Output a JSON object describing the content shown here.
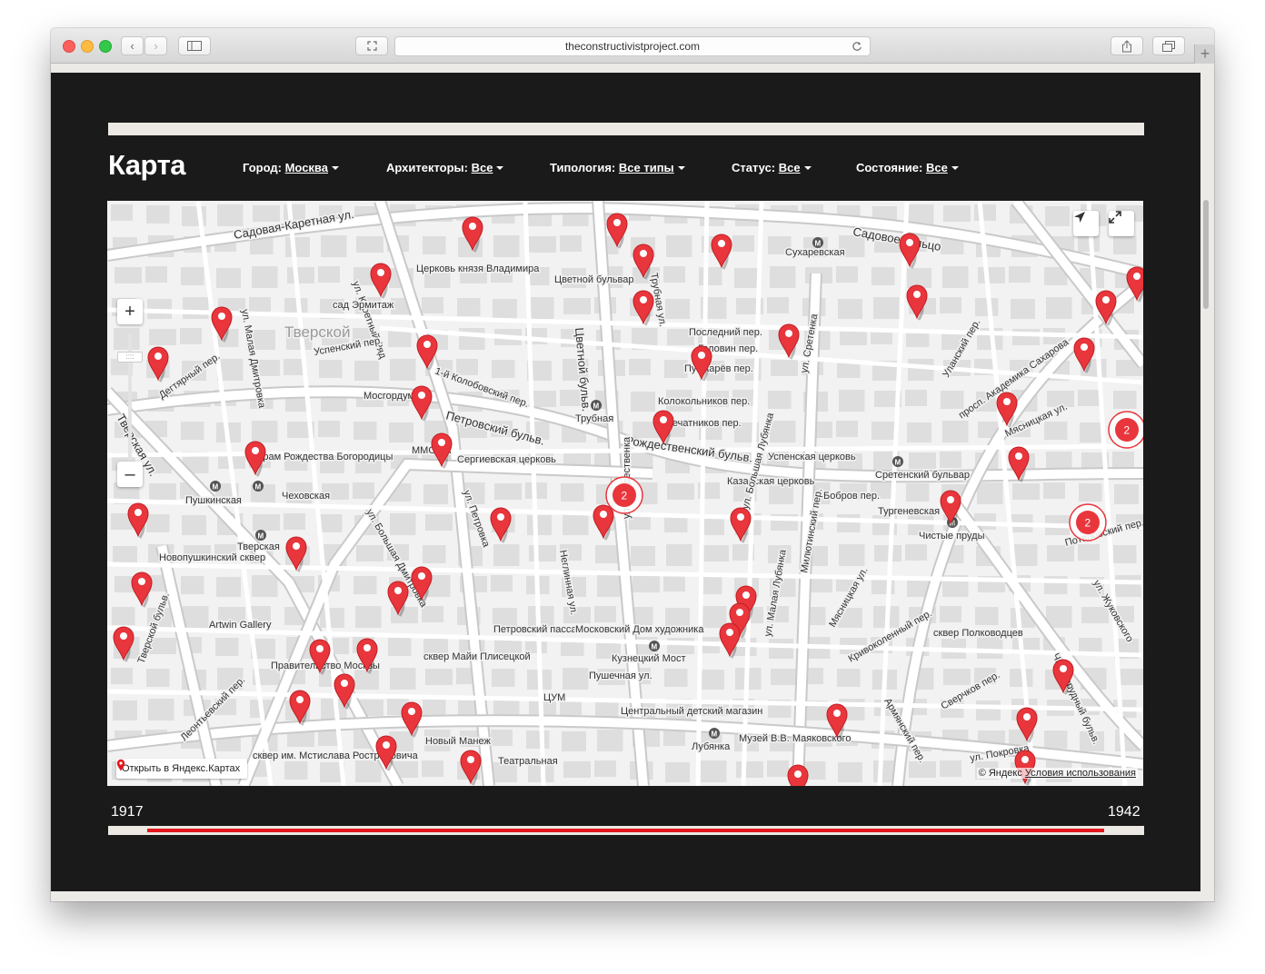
{
  "browser": {
    "url": "theconstructivistproject.com"
  },
  "header": {
    "title": "Карта",
    "filters": [
      {
        "label": "Город:",
        "value": "Москва"
      },
      {
        "label": "Архитекторы:",
        "value": "Все"
      },
      {
        "label": "Типология:",
        "value": "Все типы"
      },
      {
        "label": "Статус:",
        "value": "Все"
      },
      {
        "label": "Состояние:",
        "value": "Все"
      }
    ]
  },
  "map": {
    "open_link": "Открыть в Яндекс.Картах",
    "copyright": "© Яндекс",
    "terms": "Условия использования",
    "clusters": [
      "2",
      "2",
      "2"
    ],
    "labels": [
      "Садовая-Каретная ул.",
      "Садовое кольцо",
      "Сухаревская",
      "Цветной бульвар",
      "Трубная ул.",
      "ул. Каретный Ряд",
      "Церковь князя Владимира",
      "сад Эрмитаж",
      "Тверской",
      "Успенский пер.",
      "ул. Малая Дмитровка",
      "Дегтярный пер.",
      "Тверская ул.",
      "1-й Колобовский пер.",
      "Мосгордума",
      "Петровский бульв.",
      "Цветной бульв.",
      "Трубная",
      "Последний пер.",
      "Головин пер.",
      "Пушкарёв пер.",
      "Колокольников пер.",
      "Печатников пер.",
      "ул. Сретенка",
      "Рождественский бульв.",
      "Успенская церковь",
      "Сретенский бульвар",
      "Тургеневская",
      "Чистые пруды",
      "Храм Рождества Богородицы",
      "Пушкинская",
      "Чеховская",
      "ММОМА",
      "Сергиевская церковь",
      "ул. Петровка",
      "Казанская церковь",
      "Тверская",
      "Новопушкинский сквер",
      "ул. Большая Дмитровка",
      "Неглинная ул.",
      "ул. Рождественка",
      "ул. Большая Лубянка",
      "Бобров пер.",
      "Милютинский пер.",
      "Мясницкая ул.",
      "Кривоколенный пер.",
      "сквер Полководцев",
      "Artwin Gallery",
      "Тверской бульв.",
      "Правительство Москвы",
      "сквер Майи Плисецкой",
      "Петровский пассаж",
      "Московский Дом художника",
      "Кузнецкий Мост",
      "Пушечная ул.",
      "ЦУМ",
      "Центральный детский магазин",
      "Музей В.В. Маяковского",
      "Лубянка",
      "ул. Малая Лубянка",
      "Армянский пер.",
      "Сверчков пер.",
      "Чистопрудный бульв.",
      "ул. Покровка",
      "Леонтьевский пер.",
      "Новый Манеж",
      "Театральная",
      "сквер им. Мстислава Ростроповича",
      "просп. Академика Сахарова",
      "Уланский пер.",
      "Мясницкая ул.",
      "ул. Жуковского",
      "Потаповский пер."
    ]
  },
  "timeline": {
    "start_year": "1917",
    "end_year": "1942",
    "range_start_fraction": 0.038,
    "range_end_fraction": 0.962
  },
  "colors": {
    "page_bg": "#1a1a1a",
    "accent": "#e3171d",
    "marker": "#e8363c",
    "map_bg": "#f2f2f2"
  }
}
